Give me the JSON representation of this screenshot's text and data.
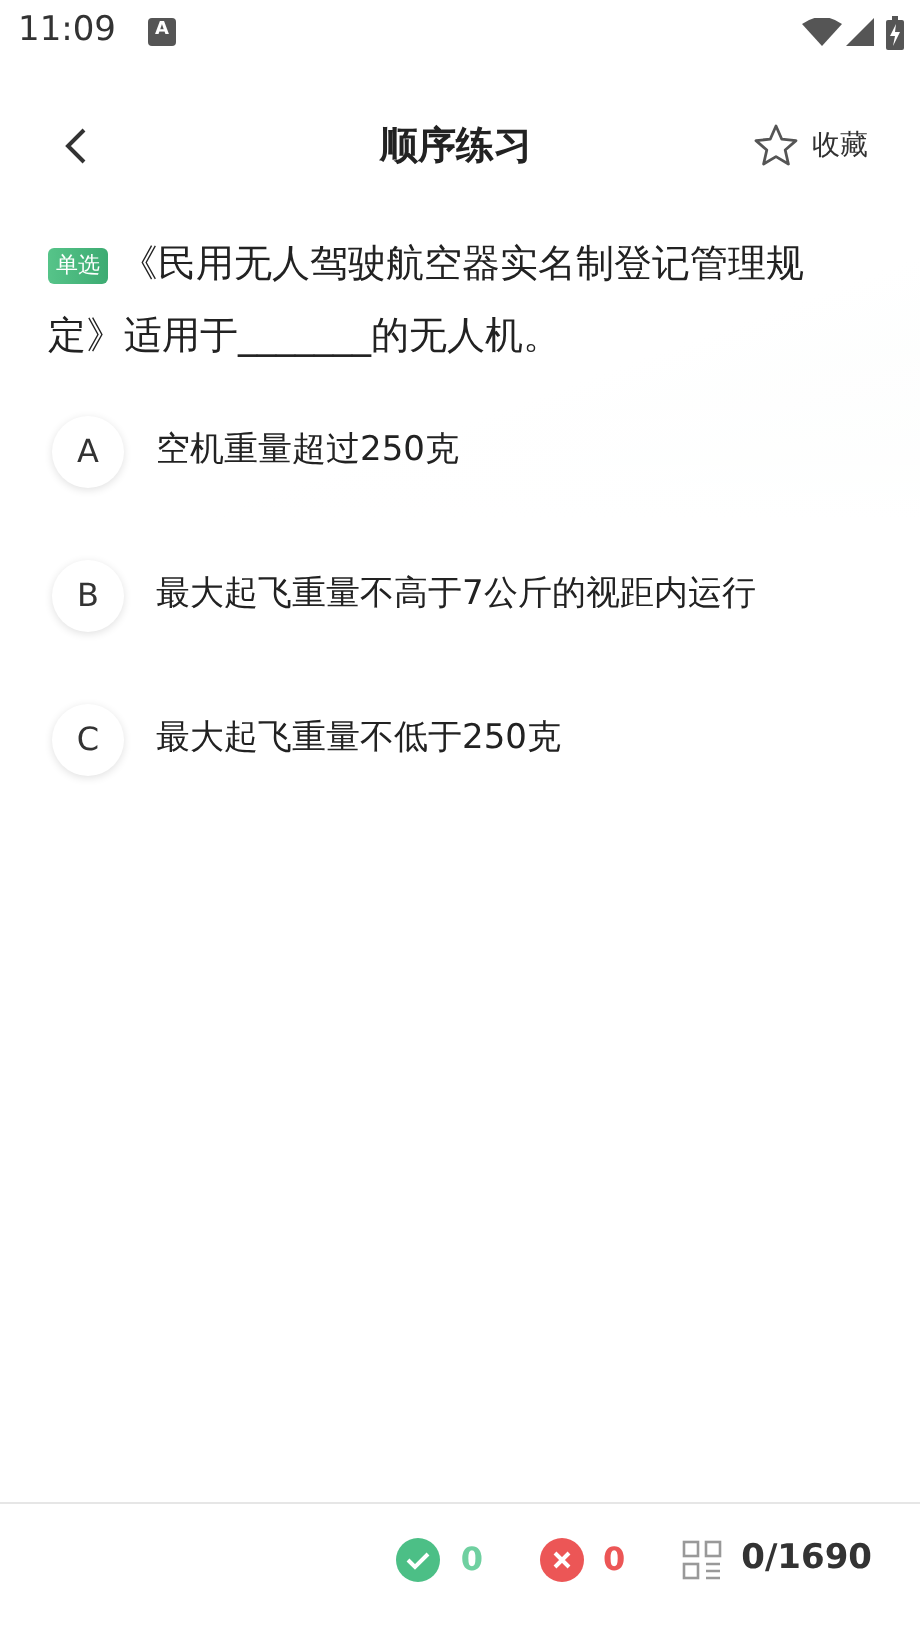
{
  "status_bar": {
    "time": "11:09",
    "notification_icon": "A"
  },
  "header": {
    "title": "顺序练习",
    "favorite": {
      "label": "收藏",
      "on": false
    }
  },
  "question": {
    "type_tag": "单选",
    "text": "《民用无人驾驶航空器实名制登记管理规定》适用于_______的无人机。"
  },
  "options": [
    {
      "letter": "A",
      "text": "空机重量超过250克",
      "selected": false
    },
    {
      "letter": "B",
      "text": "最大起飞重量不高于7公斤的视距内运行",
      "selected": false
    },
    {
      "letter": "C",
      "text": "最大起飞重量不低于250克",
      "selected": false
    }
  ],
  "footer": {
    "correct": "0",
    "wrong": "0",
    "progress": "0/1690"
  }
}
